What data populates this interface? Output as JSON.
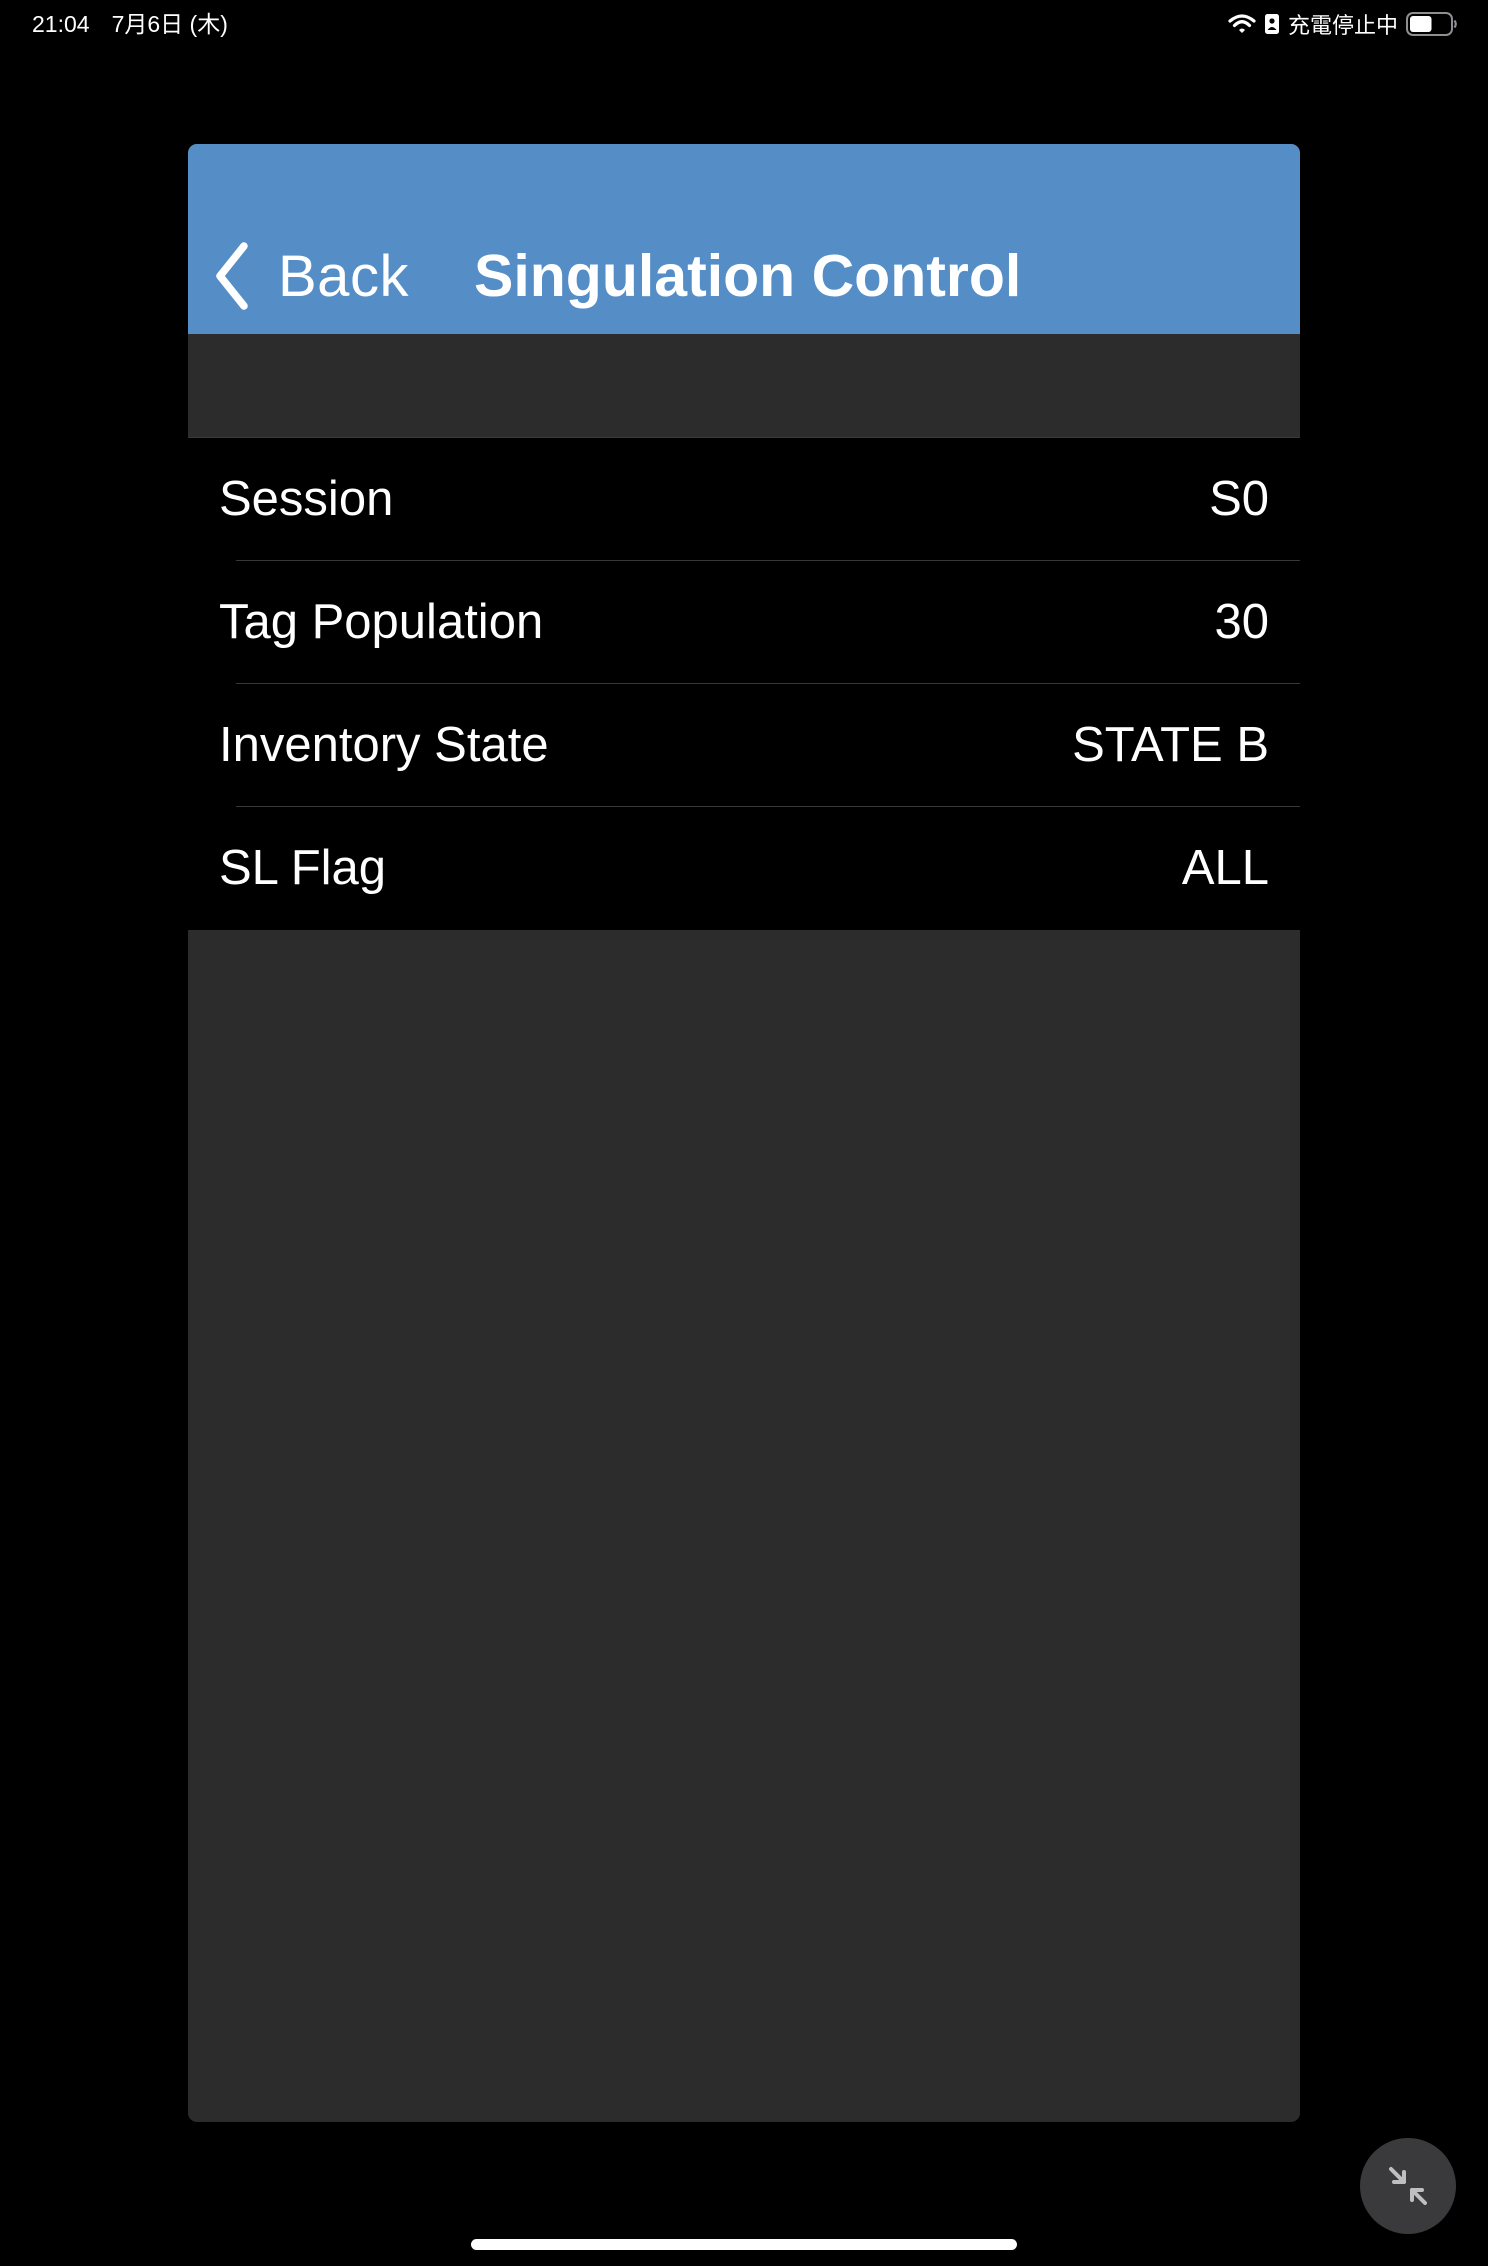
{
  "status_bar": {
    "time": "21:04",
    "date": "7月6日 (木)",
    "battery_status": "充電停止中",
    "battery_level": 0.55,
    "icons": [
      "wifi-icon",
      "sim-icon",
      "battery-icon"
    ]
  },
  "nav": {
    "back_label": "Back",
    "title": "Singulation Control",
    "background_color": "#558ec6"
  },
  "settings": {
    "rows": [
      {
        "label": "Session",
        "value": "S0"
      },
      {
        "label": "Tag Population",
        "value": "30"
      },
      {
        "label": "Inventory State",
        "value": "STATE B"
      },
      {
        "label": "SL Flag",
        "value": "ALL"
      }
    ]
  },
  "floating_button": {
    "icon": "collapse-icon"
  }
}
